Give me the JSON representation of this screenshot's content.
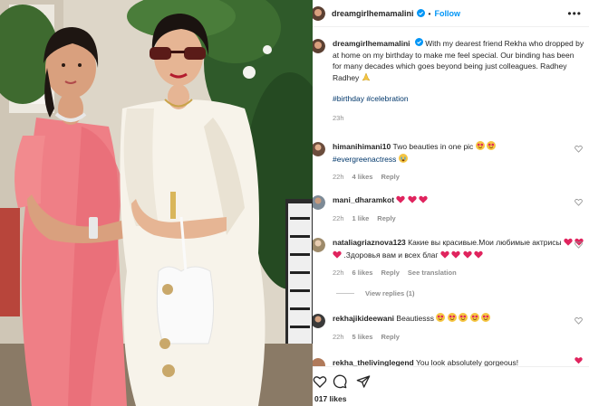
{
  "post": {
    "username": "dreamgirlhemamalini",
    "follow_label": "Follow",
    "separator": "•",
    "caption_text": "With my dearest friend Rekha who dropped by at home on my birthday to make me feel special. Our binding has been for many decades which goes beyond being just colleagues. Radhey Radhey",
    "caption_hashtags": "#birthday #celebration",
    "caption_time": "23h",
    "likes_text": "017 likes"
  },
  "icons": {
    "verified": "verified-badge-icon",
    "more": "more-options-icon",
    "like": "heart-icon",
    "comment": "comment-icon",
    "share": "share-icon",
    "save": "bookmark-icon"
  },
  "colors": {
    "link": "#0095f6",
    "hashtag": "#00376b",
    "heart": "#ed4956",
    "muted": "#8e8e8e"
  },
  "comments": [
    {
      "username": "himanihimani10",
      "text": "Two beauties in one pic",
      "hashtag": "#evergreenactress",
      "time": "22h",
      "likes": "4 likes",
      "reply": "Reply"
    },
    {
      "username": "mani_dharamkot",
      "text": "",
      "time": "22h",
      "likes": "1 like",
      "reply": "Reply"
    },
    {
      "username": "nataliagriaznova123",
      "text": "Какие вы красивые.Мои любимые актрисы",
      "text2": ".Здоровья вам и всех благ",
      "time": "22h",
      "likes": "6 likes",
      "reply": "Reply",
      "translation": "See translation",
      "view_replies": "View replies (1)"
    },
    {
      "username": "rekhajikideewani",
      "text": "Beautiesss",
      "time": "22h",
      "likes": "5 likes",
      "reply": "Reply"
    },
    {
      "username": "rekha_thelivinglegend",
      "text": "You look absolutely gorgeous!"
    }
  ]
}
